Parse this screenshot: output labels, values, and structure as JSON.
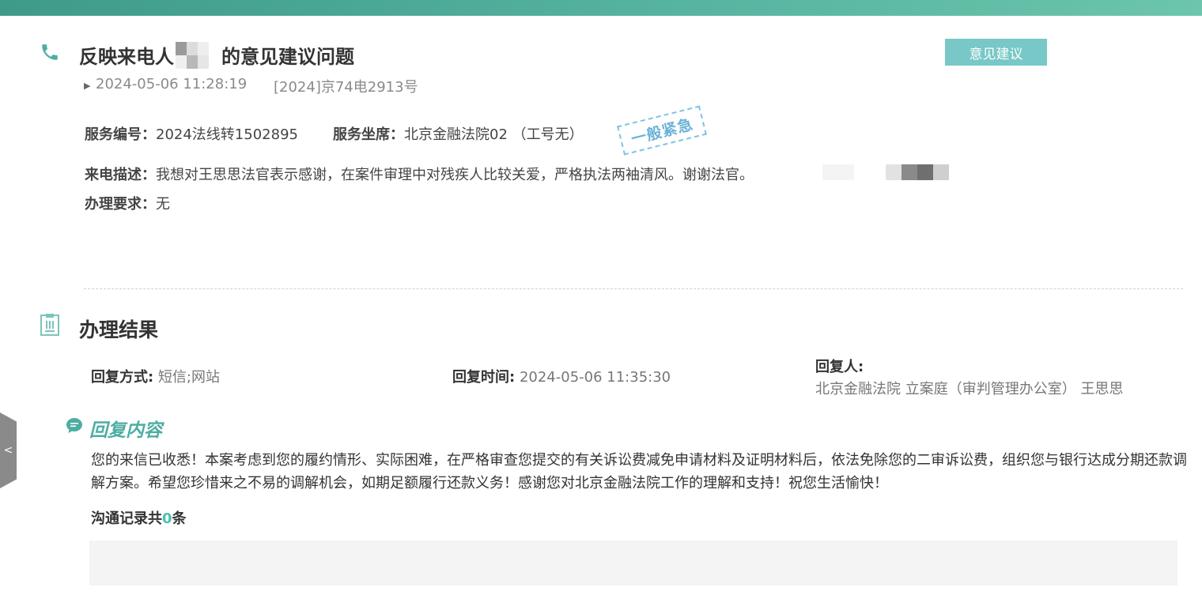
{
  "header": {
    "title_prefix": "反映来电人",
    "title_suffix": "的意见建议问题",
    "category_button": "意见建议",
    "datetime": "2024-05-06 11:28:19",
    "case_number": "[2024]京74电2913号"
  },
  "details": {
    "service_number_label": "服务编号：",
    "service_number": "2024法线转1502895",
    "service_seat_label": "服务坐席：",
    "service_seat": "北京金融法院02 （工号无）",
    "urgency_stamp": "一般紧急",
    "call_desc_label": "来电描述：",
    "call_desc": "我想对王思思法官表示感谢，在案件审理中对残疾人比较关爱，严格执法两袖清风。谢谢法官。",
    "requirement_label": "办理要求：",
    "requirement": "无"
  },
  "result": {
    "section_title": "办理结果",
    "reply_method_label": "回复方式:",
    "reply_method": "短信;网站",
    "reply_time_label": "回复时间:",
    "reply_time": "2024-05-06 11:35:30",
    "replier_label": "回复人:",
    "replier": "北京金融法院 立案庭（审判管理办公室） 王思思",
    "reply_content_title": "回复内容",
    "reply_content": "您的来信已收悉！本案考虑到您的履约情形、实际困难，在严格审查您提交的有关诉讼费减免申请材料及证明材料后，依法免除您的二审诉讼费，组织您与银行达成分期还款调解方案。希望您珍惜来之不易的调解机会，如期足额履行还款义务！感谢您对北京金融法院工作的理解和支持！祝您生活愉快！",
    "comm_prefix": "沟通记录共",
    "comm_count": "0",
    "comm_suffix": "条"
  },
  "side_tab": {
    "label": "<"
  },
  "icons": {
    "phone": "phone-icon",
    "clipboard": "clipboard-icon",
    "chat": "chat-bubble-icon"
  },
  "colors": {
    "accent": "#4dada3",
    "tag_bg": "#77c8c6",
    "stamp": "#6ab2d8"
  }
}
